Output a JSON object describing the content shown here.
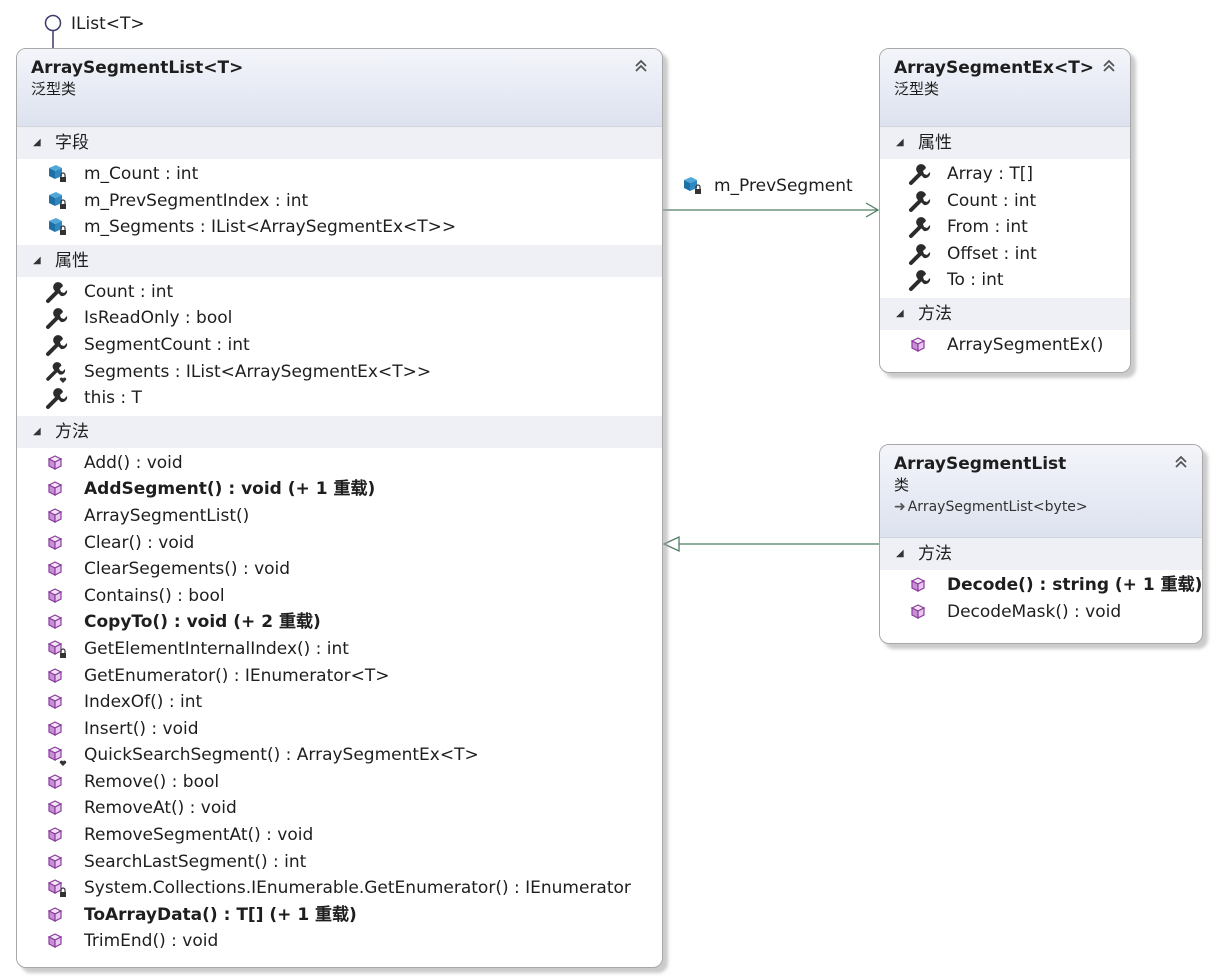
{
  "diagram": {
    "interface_lollipop": {
      "label": "IList<T>"
    },
    "association": {
      "label": "m_PrevSegment"
    },
    "classes": [
      {
        "id": "array-segment-list-generic",
        "title": "ArraySegmentList<T>",
        "kind": "泛型类",
        "sections": [
          {
            "label": "字段",
            "members": [
              {
                "text": "m_Count : int",
                "icon": "private-field-icon",
                "bold": false
              },
              {
                "text": "m_PrevSegmentIndex : int",
                "icon": "private-field-icon",
                "bold": false
              },
              {
                "text": "m_Segments : IList<ArraySegmentEx<T>>",
                "icon": "private-field-icon",
                "bold": false
              }
            ]
          },
          {
            "label": "属性",
            "members": [
              {
                "text": "Count : int",
                "icon": "property-wrench-icon",
                "bold": false
              },
              {
                "text": "IsReadOnly : bool",
                "icon": "property-wrench-icon",
                "bold": false
              },
              {
                "text": "SegmentCount : int",
                "icon": "property-wrench-icon",
                "bold": false
              },
              {
                "text": "Segments : IList<ArraySegmentEx<T>>",
                "icon": "protected-property-icon",
                "bold": false
              },
              {
                "text": "this : T",
                "icon": "property-wrench-icon",
                "bold": false
              }
            ]
          },
          {
            "label": "方法",
            "members": [
              {
                "text": "Add() : void",
                "icon": "method-cube-icon",
                "bold": false
              },
              {
                "text": "AddSegment() : void (+ 1 重载)",
                "icon": "method-cube-icon",
                "bold": true
              },
              {
                "text": "ArraySegmentList()",
                "icon": "method-cube-icon",
                "bold": false
              },
              {
                "text": "Clear() : void",
                "icon": "method-cube-icon",
                "bold": false
              },
              {
                "text": "ClearSegements() : void",
                "icon": "method-cube-icon",
                "bold": false
              },
              {
                "text": "Contains() : bool",
                "icon": "method-cube-icon",
                "bold": false
              },
              {
                "text": "CopyTo() : void (+ 2 重载)",
                "icon": "method-cube-icon",
                "bold": true
              },
              {
                "text": "GetElementInternalIndex() : int",
                "icon": "private-method-icon",
                "bold": false
              },
              {
                "text": "GetEnumerator() : IEnumerator<T>",
                "icon": "method-cube-icon",
                "bold": false
              },
              {
                "text": "IndexOf() : int",
                "icon": "method-cube-icon",
                "bold": false
              },
              {
                "text": "Insert() : void",
                "icon": "method-cube-icon",
                "bold": false
              },
              {
                "text": "QuickSearchSegment() : ArraySegmentEx<T>",
                "icon": "protected-method-icon",
                "bold": false
              },
              {
                "text": "Remove() : bool",
                "icon": "method-cube-icon",
                "bold": false
              },
              {
                "text": "RemoveAt() : void",
                "icon": "method-cube-icon",
                "bold": false
              },
              {
                "text": "RemoveSegmentAt() : void",
                "icon": "method-cube-icon",
                "bold": false
              },
              {
                "text": "SearchLastSegment() : int",
                "icon": "method-cube-icon",
                "bold": false
              },
              {
                "text": "System.Collections.IEnumerable.GetEnumerator() : IEnumerator",
                "icon": "private-method-icon",
                "bold": false
              },
              {
                "text": "ToArrayData() : T[] (+ 1 重载)",
                "icon": "method-cube-icon",
                "bold": true
              },
              {
                "text": "TrimEnd() : void",
                "icon": "method-cube-icon",
                "bold": false
              }
            ]
          }
        ]
      },
      {
        "id": "array-segment-ex",
        "title": "ArraySegmentEx<T>",
        "kind": "泛型类",
        "sections": [
          {
            "label": "属性",
            "members": [
              {
                "text": "Array : T[]",
                "icon": "property-wrench-icon",
                "bold": false
              },
              {
                "text": "Count : int",
                "icon": "property-wrench-icon",
                "bold": false
              },
              {
                "text": "From : int",
                "icon": "property-wrench-icon",
                "bold": false
              },
              {
                "text": "Offset : int",
                "icon": "property-wrench-icon",
                "bold": false
              },
              {
                "text": "To : int",
                "icon": "property-wrench-icon",
                "bold": false
              }
            ]
          },
          {
            "label": "方法",
            "members": [
              {
                "text": "ArraySegmentEx()",
                "icon": "method-cube-icon",
                "bold": false
              }
            ]
          }
        ]
      },
      {
        "id": "array-segment-list",
        "title": "ArraySegmentList",
        "kind": "类",
        "base": "ArraySegmentList<byte>",
        "sections": [
          {
            "label": "方法",
            "members": [
              {
                "text": "Decode() : string (+ 1 重载)",
                "icon": "method-cube-icon",
                "bold": true
              },
              {
                "text": "DecodeMask() : void",
                "icon": "method-cube-icon",
                "bold": false
              }
            ]
          }
        ]
      }
    ]
  }
}
